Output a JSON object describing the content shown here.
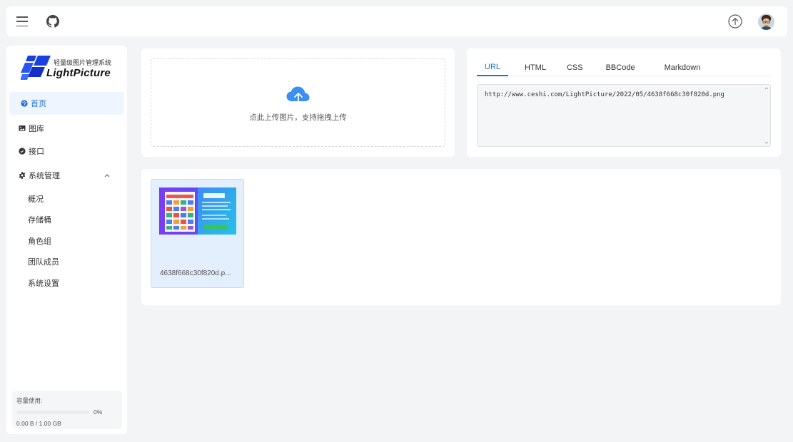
{
  "header": {
    "menu_icon": "hamburger-icon",
    "github_icon": "github-icon",
    "upload_icon": "upload-circle-icon",
    "avatar_icon": "user-avatar"
  },
  "logo": {
    "subtitle": "轻量级图片管理系统",
    "title": "LightPicture"
  },
  "sidebar": {
    "items": [
      {
        "label": "首页",
        "icon": "dashboard-icon",
        "active": true
      },
      {
        "label": "图库",
        "icon": "image-icon"
      },
      {
        "label": "接口",
        "icon": "api-icon"
      },
      {
        "label": "系统管理",
        "icon": "gear-icon",
        "expanded": true
      }
    ],
    "sub_items": [
      "概况",
      "存储桶",
      "角色组",
      "团队成员",
      "系统设置"
    ]
  },
  "storage": {
    "label": "容量使用:",
    "percent": "0%",
    "usage_fraction": 0,
    "size": "0.00 B / 1.00 GB"
  },
  "upload": {
    "hint": "点此上传图片，支持拖拽上传"
  },
  "links": {
    "tabs": [
      "URL",
      "HTML",
      "CSS",
      "BBCode",
      "Markdown"
    ],
    "active_tab": "URL",
    "value": "http://www.ceshi.com/LightPicture/2022/05/4638f668c30f820d.png"
  },
  "gallery": {
    "items": [
      {
        "name": "4638f668c30f820d.p..."
      }
    ]
  },
  "colors": {
    "accent": "#1e6fd9",
    "background": "#f3f4f6"
  }
}
